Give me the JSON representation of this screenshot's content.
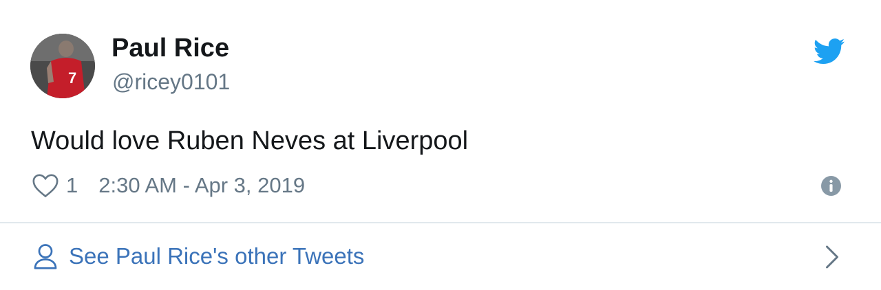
{
  "author": {
    "display_name": "Paul Rice",
    "handle": "@ricey0101",
    "avatar_icon": "footballer-avatar"
  },
  "tweet": {
    "text": "Would love Ruben Neves at Liverpool",
    "like_count": "1",
    "timestamp": "2:30 AM - Apr 3, 2019"
  },
  "footer": {
    "label": "See Paul Rice's other Tweets"
  },
  "icons": {
    "brand": "twitter-bird-icon",
    "like": "heart-icon",
    "info": "info-icon",
    "profile": "user-icon",
    "next": "chevron-right-icon"
  },
  "colors": {
    "brand_blue": "#1da1f2",
    "link_blue": "#3b73b9",
    "text_primary": "#14171a",
    "text_secondary": "#657786",
    "divider": "#e1e8ed"
  }
}
